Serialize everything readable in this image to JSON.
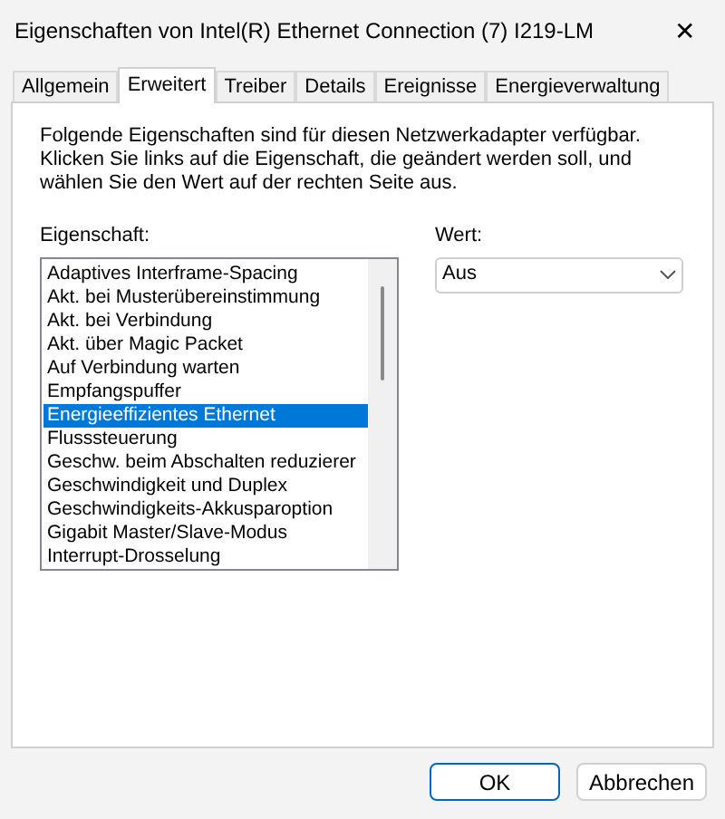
{
  "window": {
    "title": "Eigenschaften von Intel(R) Ethernet Connection (7) I219-LM",
    "close": "✕"
  },
  "tabs": [
    {
      "label": "Allgemein",
      "selected": false
    },
    {
      "label": "Erweitert",
      "selected": true
    },
    {
      "label": "Treiber",
      "selected": false
    },
    {
      "label": "Details",
      "selected": false
    },
    {
      "label": "Ereignisse",
      "selected": false
    },
    {
      "label": "Energieverwaltung",
      "selected": false
    }
  ],
  "description": "Folgende Eigenschaften sind für diesen Netzwerkadapter verfügbar. Klicken Sie links auf die Eigenschaft, die geändert werden soll, und wählen Sie den Wert auf der rechten Seite aus.",
  "property_label": "Eigenschaft:",
  "properties": [
    {
      "label": "Adaptives Interframe-Spacing",
      "selected": false
    },
    {
      "label": "Akt. bei Musterübereinstimmung",
      "selected": false
    },
    {
      "label": "Akt. bei Verbindung",
      "selected": false
    },
    {
      "label": "Akt. über Magic Packet",
      "selected": false
    },
    {
      "label": "Auf Verbindung warten",
      "selected": false
    },
    {
      "label": "Empfangspuffer",
      "selected": false
    },
    {
      "label": "Energieeffizientes Ethernet",
      "selected": true
    },
    {
      "label": "Flusssteuerung",
      "selected": false
    },
    {
      "label": "Geschw. beim Abschalten reduzierer",
      "selected": false
    },
    {
      "label": "Geschwindigkeit und Duplex",
      "selected": false
    },
    {
      "label": "Geschwindigkeits-Akkusparoption",
      "selected": false
    },
    {
      "label": "Gigabit Master/Slave-Modus",
      "selected": false
    },
    {
      "label": "Interrupt-Drosselung",
      "selected": false
    }
  ],
  "value_label": "Wert:",
  "value": "Aus",
  "buttons": [
    {
      "label": "OK",
      "default": true
    },
    {
      "label": "Abbrechen",
      "default": false
    }
  ]
}
